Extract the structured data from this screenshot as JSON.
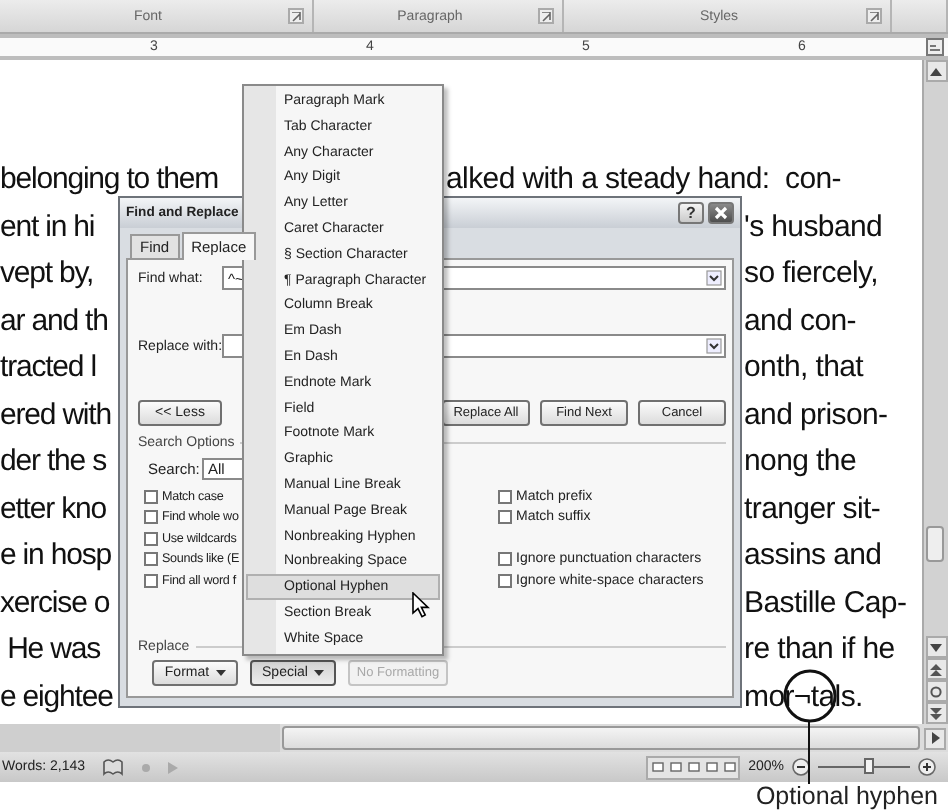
{
  "ribbon_groups": [
    {
      "label": "Font"
    },
    {
      "label": "Paragraph"
    },
    {
      "label": "Styles"
    }
  ],
  "ruler": {
    "numbers": [
      "3",
      "4",
      "5",
      "6"
    ]
  },
  "document": {
    "lines": [
      {
        "left": "belonging to them",
        "right": "alked with a steady hand:  con-"
      },
      {
        "left": "ent in hi",
        "right": "'s husband"
      },
      {
        "left": "vept by,",
        "right": "so fiercely,"
      },
      {
        "left": "ar and th",
        "right": "and con-"
      },
      {
        "left": "tracted l",
        "right": "onth, that"
      },
      {
        "left": "ered with",
        "right": "and prison-"
      },
      {
        "left": "der the s",
        "right": "nong the"
      },
      {
        "left": "etter kno",
        "right": "tranger sit-"
      },
      {
        "left": "e in hosp",
        "right": "assins and"
      },
      {
        "left": "xercise o",
        "right": "Bastille Cap-"
      },
      {
        "left": " He was",
        "right": "re than if he"
      },
      {
        "left": "e eightee",
        "right": "mor¬tals."
      }
    ]
  },
  "dialog": {
    "title": "Find and Replace",
    "help_button": "?",
    "tabs": [
      {
        "label": "Find",
        "selected": false
      },
      {
        "label": "Replace",
        "selected": true
      }
    ],
    "find_what": {
      "label": "Find what:",
      "value": "^~"
    },
    "replace_with": {
      "label": "Replace with:"
    },
    "less_button": "<< Less",
    "action_buttons": [
      "Replace All",
      "Find Next",
      "Cancel"
    ],
    "search_options": {
      "heading": "Search Options",
      "search_label": "Search:",
      "search_value": "All",
      "left_options": [
        {
          "label": "Match case",
          "checked": false
        },
        {
          "label": "Find whole wo",
          "checked": false
        },
        {
          "label": "Use wildcards",
          "checked": false
        },
        {
          "label": "Sounds like (E",
          "checked": false
        },
        {
          "label": "Find all word f",
          "checked": false
        }
      ],
      "right_groups": [
        [
          {
            "label": "Match prefix",
            "checked": false
          },
          {
            "label": "Match suffix",
            "checked": false
          }
        ],
        [
          {
            "label": "Ignore punctuation characters",
            "checked": false
          },
          {
            "label": "Ignore white-space characters",
            "checked": false
          }
        ]
      ]
    },
    "replace_section": {
      "heading": "Replace",
      "buttons": [
        {
          "label": "Format",
          "dropdown": true,
          "pressed": false,
          "disabled": false
        },
        {
          "label": "Special",
          "dropdown": true,
          "pressed": true,
          "disabled": false
        },
        {
          "label": "No Formatting",
          "dropdown": false,
          "pressed": false,
          "disabled": true
        }
      ]
    }
  },
  "special_menu": {
    "items": [
      {
        "label": "Paragraph Mark",
        "selected": false
      },
      {
        "label": "Tab Character",
        "selected": false
      },
      {
        "label": "Any Character",
        "selected": false
      },
      {
        "label": "Any Digit",
        "selected": false
      },
      {
        "label": "Any Letter",
        "selected": false
      },
      {
        "label": "Caret Character",
        "selected": false
      },
      {
        "label": "§ Section Character",
        "selected": false
      },
      {
        "label": "¶ Paragraph Character",
        "selected": false
      },
      {
        "label": "Column Break",
        "selected": false
      },
      {
        "label": "Em Dash",
        "selected": false
      },
      {
        "label": "En Dash",
        "selected": false
      },
      {
        "label": "Endnote Mark",
        "selected": false
      },
      {
        "label": "Field",
        "selected": false
      },
      {
        "label": "Footnote Mark",
        "selected": false
      },
      {
        "label": "Graphic",
        "selected": false
      },
      {
        "label": "Manual Line Break",
        "selected": false
      },
      {
        "label": "Manual Page Break",
        "selected": false
      },
      {
        "label": "Nonbreaking Hyphen",
        "selected": false
      },
      {
        "label": "Nonbreaking Space",
        "selected": false
      },
      {
        "label": "Optional Hyphen",
        "selected": true
      },
      {
        "label": "Section Break",
        "selected": false
      },
      {
        "label": "White Space",
        "selected": false
      }
    ]
  },
  "status_bar": {
    "word_count": "Words: 2,143",
    "zoom": "200%",
    "zoom_slider": {
      "level": 0.55
    }
  },
  "callout": {
    "label": "Optional hyphen"
  }
}
